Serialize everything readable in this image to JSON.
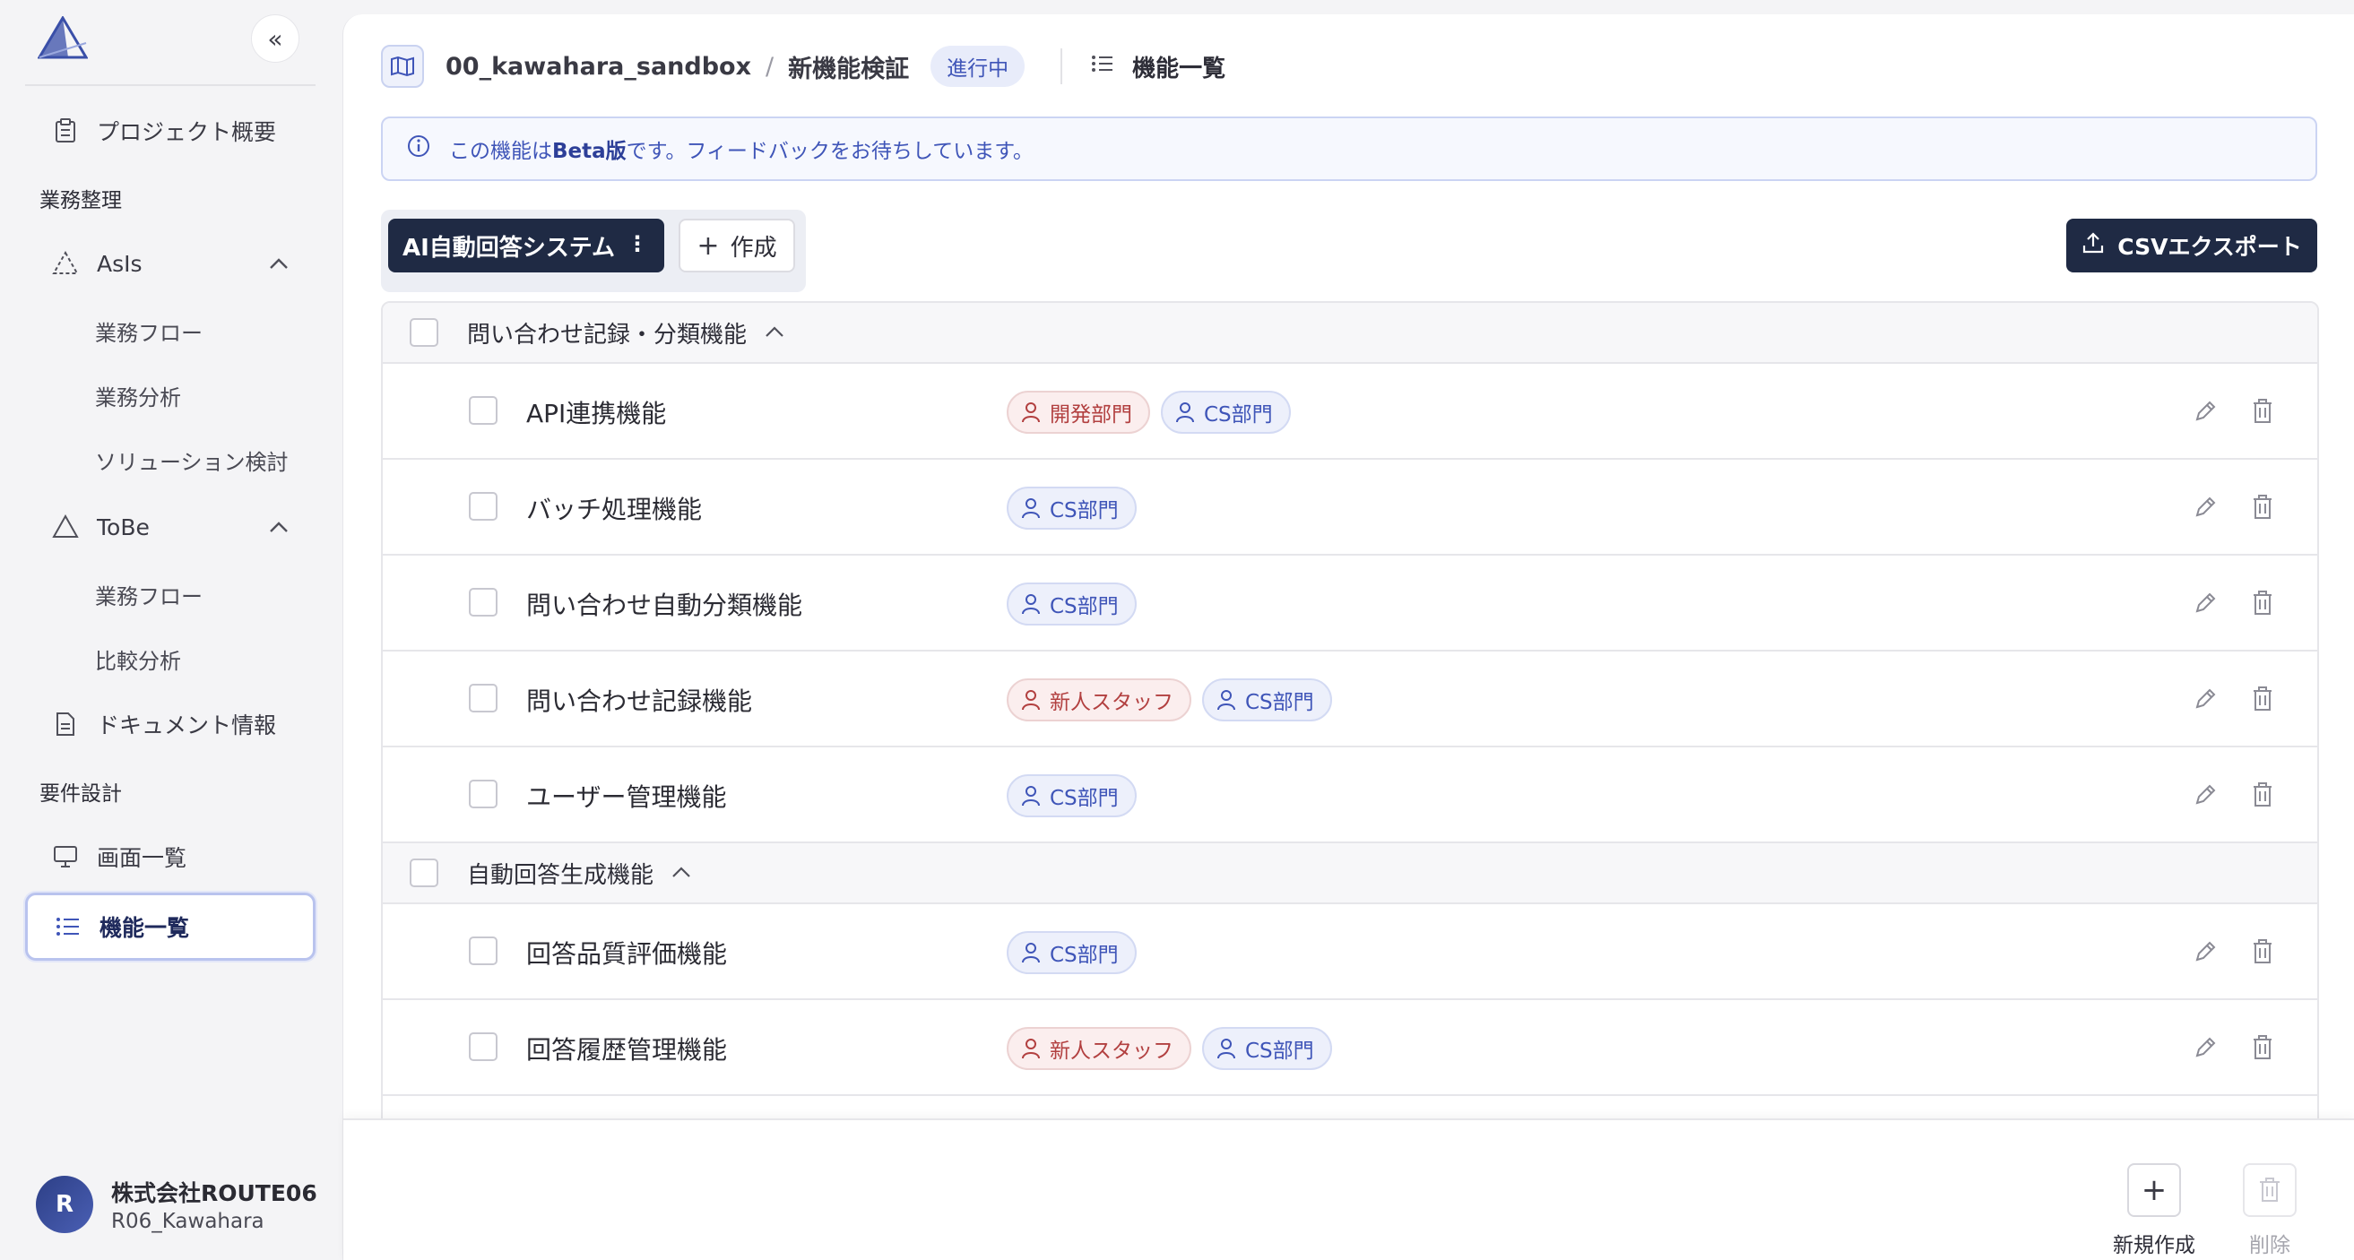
{
  "sidebar": {
    "collapse_label": "«",
    "project_overview": "プロジェクト概要",
    "section_business": "業務整理",
    "asis": {
      "label": "AsIs",
      "items": [
        "業務フロー",
        "業務分析",
        "ソリューション検討"
      ]
    },
    "tobe": {
      "label": "ToBe",
      "items": [
        "業務フロー",
        "比較分析"
      ]
    },
    "documents": "ドキュメント情報",
    "section_requirements": "要件設計",
    "screens": "画面一覧",
    "features": "機能一覧",
    "user": {
      "initial": "R",
      "org": "株式会社ROUTE06",
      "name": "R06_Kawahara"
    }
  },
  "header": {
    "project": "00_kawahara_sandbox",
    "separator": "/",
    "subproject": "新機能検証",
    "status": "進行中",
    "page_title": "機能一覧"
  },
  "banner": {
    "prefix": "この機能は",
    "highlight": "Beta版",
    "suffix": "です。フィードバックをお待ちしています。"
  },
  "toolbar": {
    "system_tab": "AI自動回答システム",
    "system_menu": "⋮",
    "create_label": "作成",
    "create_plus": "+",
    "csv_label": "CSVエクスポート"
  },
  "groups": [
    {
      "name": "問い合わせ記録・分類機能",
      "items": [
        {
          "name": "API連携機能",
          "tags": [
            {
              "label": "開発部門",
              "color": "red"
            },
            {
              "label": "CS部門",
              "color": "blue"
            }
          ]
        },
        {
          "name": "バッチ処理機能",
          "tags": [
            {
              "label": "CS部門",
              "color": "blue"
            }
          ]
        },
        {
          "name": "問い合わせ自動分類機能",
          "tags": [
            {
              "label": "CS部門",
              "color": "blue"
            }
          ]
        },
        {
          "name": "問い合わせ記録機能",
          "tags": [
            {
              "label": "新人スタッフ",
              "color": "red"
            },
            {
              "label": "CS部門",
              "color": "blue"
            }
          ]
        },
        {
          "name": "ユーザー管理機能",
          "tags": [
            {
              "label": "CS部門",
              "color": "blue"
            }
          ]
        }
      ]
    },
    {
      "name": "自動回答生成機能",
      "items": [
        {
          "name": "回答品質評価機能",
          "tags": [
            {
              "label": "CS部門",
              "color": "blue"
            }
          ]
        },
        {
          "name": "回答履歴管理機能",
          "tags": [
            {
              "label": "新人スタッフ",
              "color": "red"
            },
            {
              "label": "CS部門",
              "color": "blue"
            }
          ]
        }
      ]
    }
  ],
  "bottom": {
    "new_label": "新規作成",
    "new_icon": "+",
    "delete_label": "削除"
  },
  "colors": {
    "accent": "#3f55b8",
    "dark": "#1f2a44",
    "tag_red": "#b24040",
    "tag_blue": "#3f55b8"
  }
}
